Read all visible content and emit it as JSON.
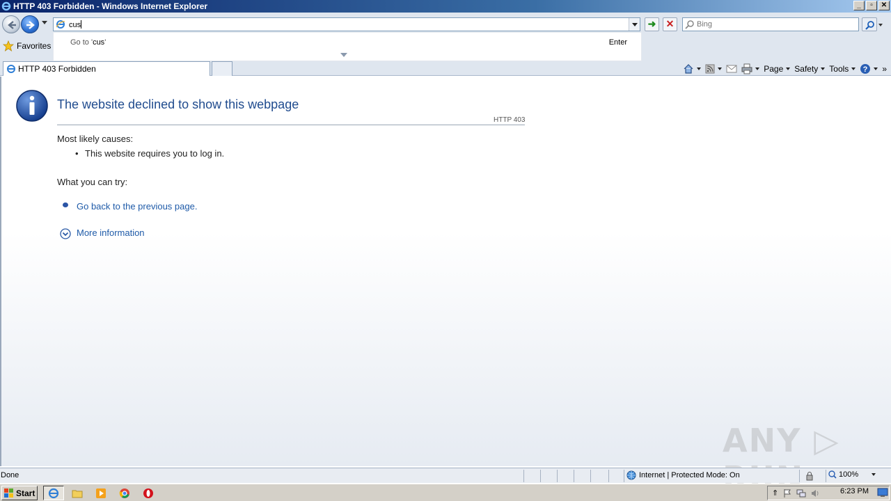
{
  "window": {
    "title": "HTTP 403 Forbidden - Windows Internet Explorer",
    "controls": [
      "_",
      "▫",
      "✕"
    ]
  },
  "address_bar": {
    "value": "cus"
  },
  "search": {
    "placeholder": "Bing"
  },
  "favorites": {
    "label": "Favorites"
  },
  "autocomplete": {
    "goto_prefix": "Go to '",
    "goto_value": "cus",
    "goto_suffix": "'",
    "enter_label": "Enter"
  },
  "tab": {
    "label": "HTTP 403 Forbidden"
  },
  "command_bar": {
    "page": "Page",
    "safety": "Safety",
    "tools": "Tools",
    "more": "»"
  },
  "error_page": {
    "title": "The website declined to show this webpage",
    "code": "HTTP 403",
    "causes_heading": "Most likely causes:",
    "causes": [
      "This website requires you to log in."
    ],
    "try_heading": "What you can try:",
    "back_link": "Go back to the previous page.",
    "more_info": "More information"
  },
  "watermark": {
    "text": "ANY ▷ RUN"
  },
  "status_bar": {
    "text": "Done",
    "zone": "Internet | Protected Mode: On",
    "zoom": "100%"
  },
  "taskbar": {
    "start_label": "Start",
    "clock": "6:23 PM"
  }
}
